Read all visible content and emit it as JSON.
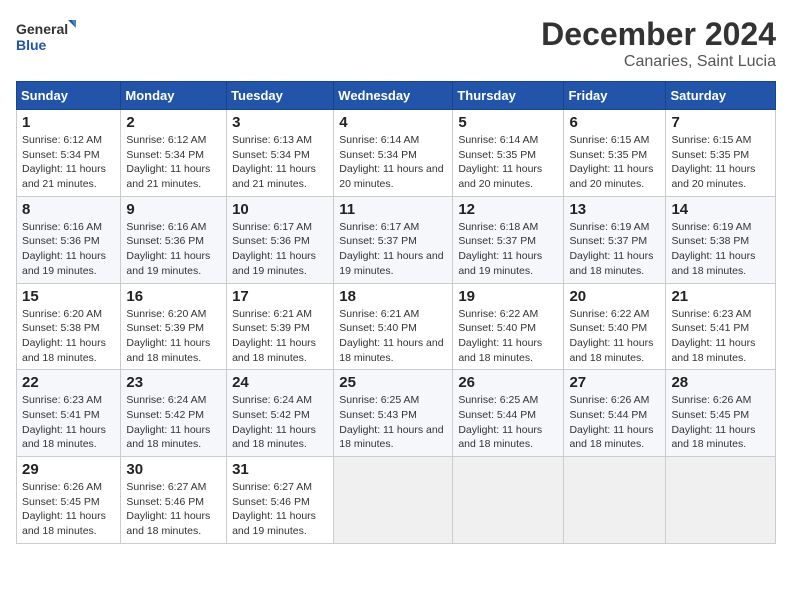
{
  "logo": {
    "line1": "General",
    "line2": "Blue"
  },
  "title": "December 2024",
  "subtitle": "Canaries, Saint Lucia",
  "days_of_week": [
    "Sunday",
    "Monday",
    "Tuesday",
    "Wednesday",
    "Thursday",
    "Friday",
    "Saturday"
  ],
  "weeks": [
    [
      {
        "day": "1",
        "sunrise": "6:12 AM",
        "sunset": "5:34 PM",
        "daylight": "11 hours and 21 minutes."
      },
      {
        "day": "2",
        "sunrise": "6:12 AM",
        "sunset": "5:34 PM",
        "daylight": "11 hours and 21 minutes."
      },
      {
        "day": "3",
        "sunrise": "6:13 AM",
        "sunset": "5:34 PM",
        "daylight": "11 hours and 21 minutes."
      },
      {
        "day": "4",
        "sunrise": "6:14 AM",
        "sunset": "5:34 PM",
        "daylight": "11 hours and 20 minutes."
      },
      {
        "day": "5",
        "sunrise": "6:14 AM",
        "sunset": "5:35 PM",
        "daylight": "11 hours and 20 minutes."
      },
      {
        "day": "6",
        "sunrise": "6:15 AM",
        "sunset": "5:35 PM",
        "daylight": "11 hours and 20 minutes."
      },
      {
        "day": "7",
        "sunrise": "6:15 AM",
        "sunset": "5:35 PM",
        "daylight": "11 hours and 20 minutes."
      }
    ],
    [
      {
        "day": "8",
        "sunrise": "6:16 AM",
        "sunset": "5:36 PM",
        "daylight": "11 hours and 19 minutes."
      },
      {
        "day": "9",
        "sunrise": "6:16 AM",
        "sunset": "5:36 PM",
        "daylight": "11 hours and 19 minutes."
      },
      {
        "day": "10",
        "sunrise": "6:17 AM",
        "sunset": "5:36 PM",
        "daylight": "11 hours and 19 minutes."
      },
      {
        "day": "11",
        "sunrise": "6:17 AM",
        "sunset": "5:37 PM",
        "daylight": "11 hours and 19 minutes."
      },
      {
        "day": "12",
        "sunrise": "6:18 AM",
        "sunset": "5:37 PM",
        "daylight": "11 hours and 19 minutes."
      },
      {
        "day": "13",
        "sunrise": "6:19 AM",
        "sunset": "5:37 PM",
        "daylight": "11 hours and 18 minutes."
      },
      {
        "day": "14",
        "sunrise": "6:19 AM",
        "sunset": "5:38 PM",
        "daylight": "11 hours and 18 minutes."
      }
    ],
    [
      {
        "day": "15",
        "sunrise": "6:20 AM",
        "sunset": "5:38 PM",
        "daylight": "11 hours and 18 minutes."
      },
      {
        "day": "16",
        "sunrise": "6:20 AM",
        "sunset": "5:39 PM",
        "daylight": "11 hours and 18 minutes."
      },
      {
        "day": "17",
        "sunrise": "6:21 AM",
        "sunset": "5:39 PM",
        "daylight": "11 hours and 18 minutes."
      },
      {
        "day": "18",
        "sunrise": "6:21 AM",
        "sunset": "5:40 PM",
        "daylight": "11 hours and 18 minutes."
      },
      {
        "day": "19",
        "sunrise": "6:22 AM",
        "sunset": "5:40 PM",
        "daylight": "11 hours and 18 minutes."
      },
      {
        "day": "20",
        "sunrise": "6:22 AM",
        "sunset": "5:40 PM",
        "daylight": "11 hours and 18 minutes."
      },
      {
        "day": "21",
        "sunrise": "6:23 AM",
        "sunset": "5:41 PM",
        "daylight": "11 hours and 18 minutes."
      }
    ],
    [
      {
        "day": "22",
        "sunrise": "6:23 AM",
        "sunset": "5:41 PM",
        "daylight": "11 hours and 18 minutes."
      },
      {
        "day": "23",
        "sunrise": "6:24 AM",
        "sunset": "5:42 PM",
        "daylight": "11 hours and 18 minutes."
      },
      {
        "day": "24",
        "sunrise": "6:24 AM",
        "sunset": "5:42 PM",
        "daylight": "11 hours and 18 minutes."
      },
      {
        "day": "25",
        "sunrise": "6:25 AM",
        "sunset": "5:43 PM",
        "daylight": "11 hours and 18 minutes."
      },
      {
        "day": "26",
        "sunrise": "6:25 AM",
        "sunset": "5:44 PM",
        "daylight": "11 hours and 18 minutes."
      },
      {
        "day": "27",
        "sunrise": "6:26 AM",
        "sunset": "5:44 PM",
        "daylight": "11 hours and 18 minutes."
      },
      {
        "day": "28",
        "sunrise": "6:26 AM",
        "sunset": "5:45 PM",
        "daylight": "11 hours and 18 minutes."
      }
    ],
    [
      {
        "day": "29",
        "sunrise": "6:26 AM",
        "sunset": "5:45 PM",
        "daylight": "11 hours and 18 minutes."
      },
      {
        "day": "30",
        "sunrise": "6:27 AM",
        "sunset": "5:46 PM",
        "daylight": "11 hours and 18 minutes."
      },
      {
        "day": "31",
        "sunrise": "6:27 AM",
        "sunset": "5:46 PM",
        "daylight": "11 hours and 19 minutes."
      },
      null,
      null,
      null,
      null
    ]
  ],
  "labels": {
    "sunrise": "Sunrise: ",
    "sunset": "Sunset: ",
    "daylight": "Daylight: "
  }
}
